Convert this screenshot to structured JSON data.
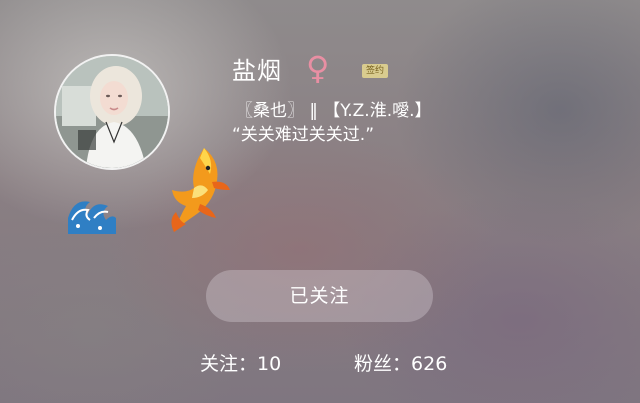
{
  "profile": {
    "name": "盐烟",
    "gender_symbol": "♀",
    "sign_badge": "签约",
    "bio_line1": "〖桑也〗 ‖ 【Y.Z.淮.噯.】",
    "bio_line2": "“关关难过关关过.”"
  },
  "follow_button": {
    "label": "已关注"
  },
  "stats": {
    "following_label": "关注：",
    "following_count": "10",
    "fans_label": "粉丝：",
    "fans_count": "626"
  },
  "colors": {
    "gender_symbol": "#e88fa3",
    "badge_background": "#d9cc8f",
    "badge_text": "#7a6422",
    "text": "#ffffff"
  },
  "icons": {
    "avatar_decoration": "koi-fish-icon",
    "avatar_wave": "wave-icon"
  }
}
